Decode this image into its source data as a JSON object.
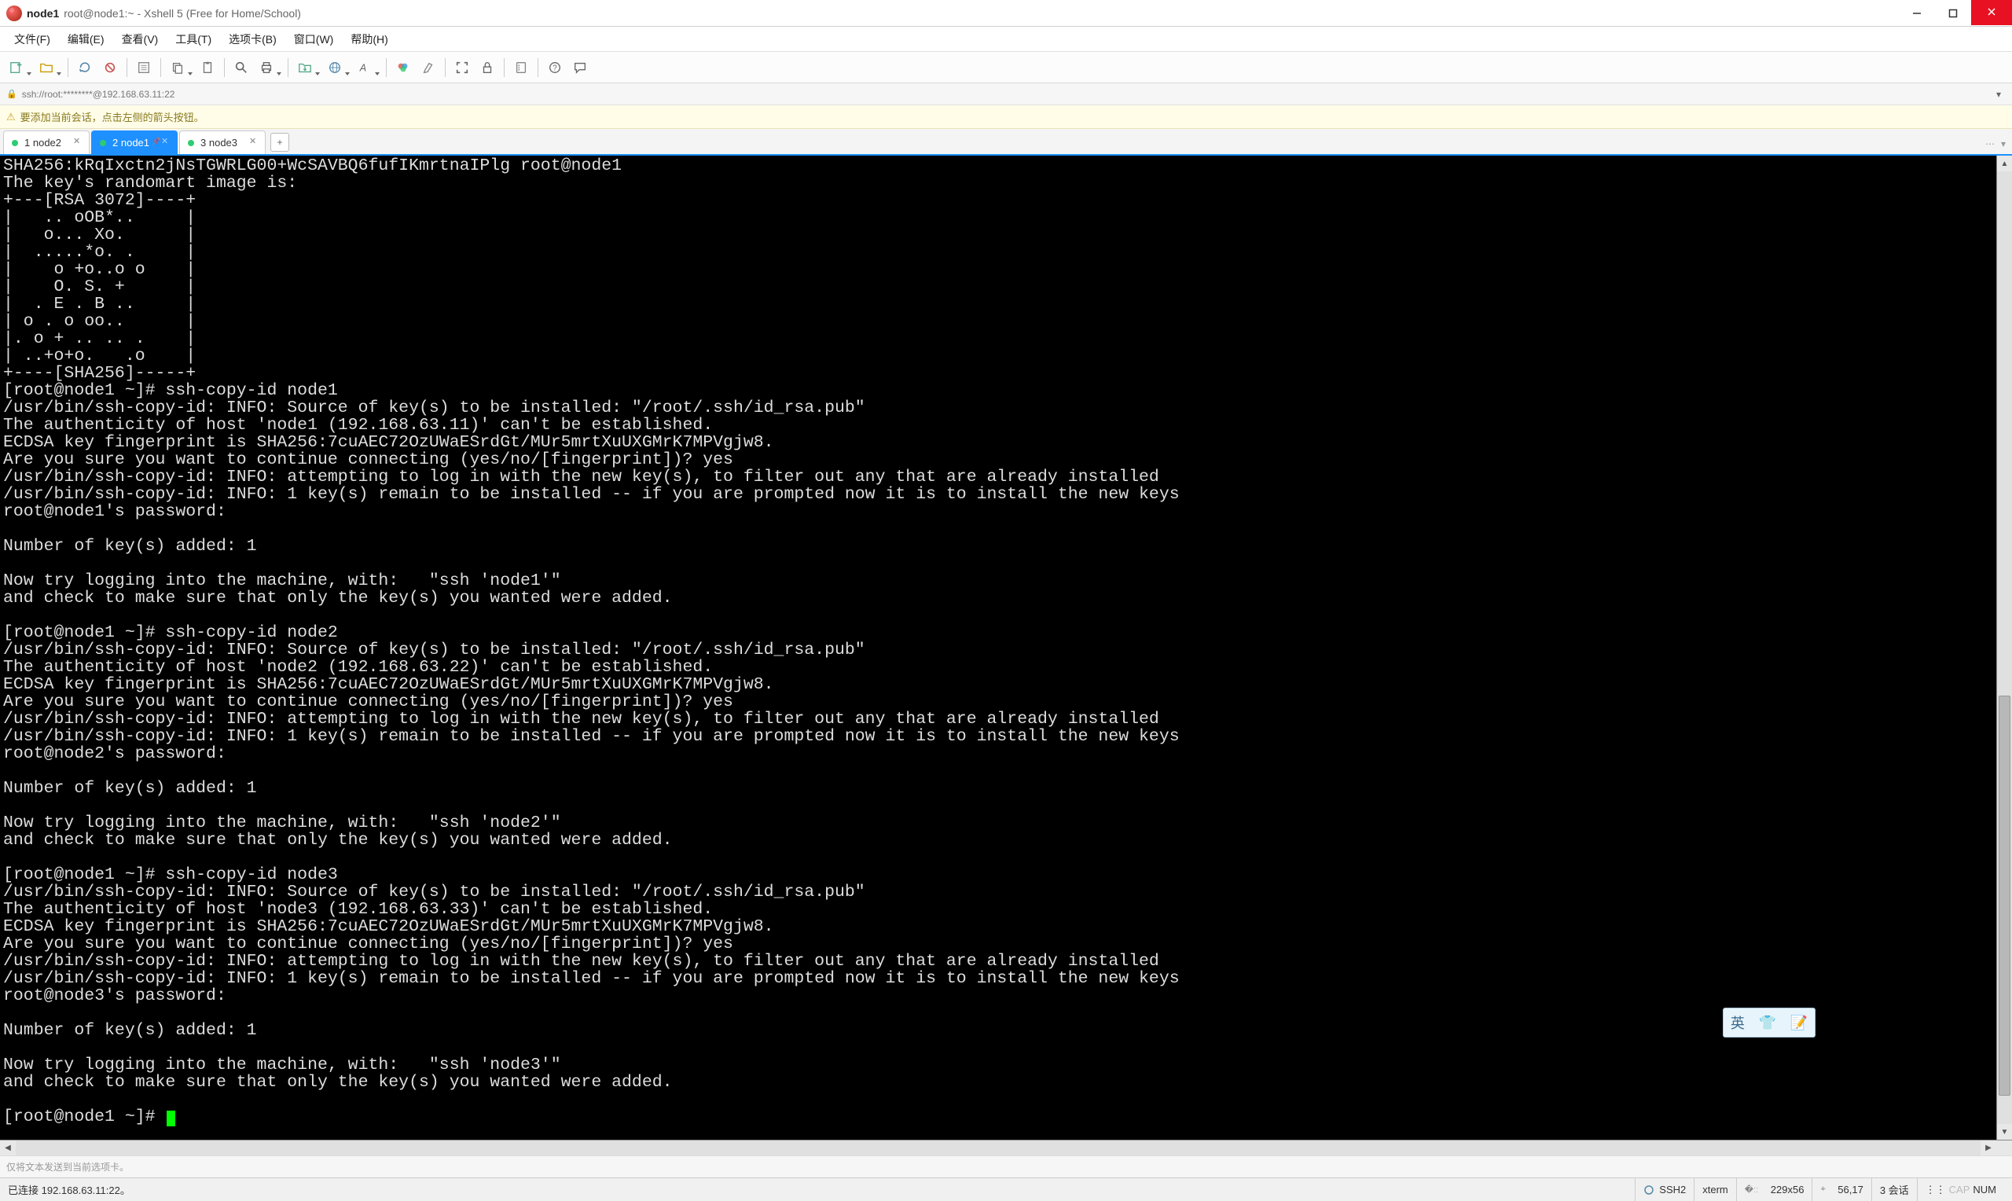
{
  "titleBar": {
    "mainTitle": "node1",
    "subTitle": "root@node1:~ - Xshell 5 (Free for Home/School)"
  },
  "menu": {
    "items": [
      "文件(F)",
      "编辑(E)",
      "查看(V)",
      "工具(T)",
      "选项卡(B)",
      "窗口(W)",
      "帮助(H)"
    ]
  },
  "addressBar": {
    "text": "ssh://root:********@192.168.63.11:22"
  },
  "infoBar": {
    "text": "要添加当前会话，点击左侧的箭头按钮。"
  },
  "tabs": {
    "items": [
      {
        "num": "1",
        "label": "node2",
        "active": false
      },
      {
        "num": "2",
        "label": "node1",
        "active": true
      },
      {
        "num": "3",
        "label": "node3",
        "active": false
      }
    ]
  },
  "terminal": {
    "content": "SHA256:kRqIxctn2jNsTGWRLG00+WcSAVBQ6fufIKmrtnaIPlg root@node1\nThe key's randomart image is:\n+---[RSA 3072]----+\n|   .. oOB*..     |\n|   o... Xo.      |\n|  .....*o. .     |\n|    o +o..o o    |\n|    O. S. +      |\n|  . E . B ..     |\n| o . o oo..      |\n|. o + .. .. .    |\n| ..+o+o.   .o    |\n+----[SHA256]-----+\n[root@node1 ~]# ssh-copy-id node1\n/usr/bin/ssh-copy-id: INFO: Source of key(s) to be installed: \"/root/.ssh/id_rsa.pub\"\nThe authenticity of host 'node1 (192.168.63.11)' can't be established.\nECDSA key fingerprint is SHA256:7cuAEC72OzUWaESrdGt/MUr5mrtXuUXGMrK7MPVgjw8.\nAre you sure you want to continue connecting (yes/no/[fingerprint])? yes\n/usr/bin/ssh-copy-id: INFO: attempting to log in with the new key(s), to filter out any that are already installed\n/usr/bin/ssh-copy-id: INFO: 1 key(s) remain to be installed -- if you are prompted now it is to install the new keys\nroot@node1's password: \n\nNumber of key(s) added: 1\n\nNow try logging into the machine, with:   \"ssh 'node1'\"\nand check to make sure that only the key(s) you wanted were added.\n\n[root@node1 ~]# ssh-copy-id node2\n/usr/bin/ssh-copy-id: INFO: Source of key(s) to be installed: \"/root/.ssh/id_rsa.pub\"\nThe authenticity of host 'node2 (192.168.63.22)' can't be established.\nECDSA key fingerprint is SHA256:7cuAEC72OzUWaESrdGt/MUr5mrtXuUXGMrK7MPVgjw8.\nAre you sure you want to continue connecting (yes/no/[fingerprint])? yes\n/usr/bin/ssh-copy-id: INFO: attempting to log in with the new key(s), to filter out any that are already installed\n/usr/bin/ssh-copy-id: INFO: 1 key(s) remain to be installed -- if you are prompted now it is to install the new keys\nroot@node2's password: \n\nNumber of key(s) added: 1\n\nNow try logging into the machine, with:   \"ssh 'node2'\"\nand check to make sure that only the key(s) you wanted were added.\n\n[root@node1 ~]# ssh-copy-id node3\n/usr/bin/ssh-copy-id: INFO: Source of key(s) to be installed: \"/root/.ssh/id_rsa.pub\"\nThe authenticity of host 'node3 (192.168.63.33)' can't be established.\nECDSA key fingerprint is SHA256:7cuAEC72OzUWaESrdGt/MUr5mrtXuUXGMrK7MPVgjw8.\nAre you sure you want to continue connecting (yes/no/[fingerprint])? yes\n/usr/bin/ssh-copy-id: INFO: attempting to log in with the new key(s), to filter out any that are already installed\n/usr/bin/ssh-copy-id: INFO: 1 key(s) remain to be installed -- if you are prompted now it is to install the new keys\nroot@node3's password: \n\nNumber of key(s) added: 1\n\nNow try logging into the machine, with:   \"ssh 'node3'\"\nand check to make sure that only the key(s) you wanted were added.\n\n[root@node1 ~]# "
  },
  "hintBar": {
    "text": "仅将文本发送到当前选项卡。"
  },
  "statusBar": {
    "left": "已连接 192.168.63.11:22。",
    "proto": "SSH2",
    "termType": "xterm",
    "size": "229x56",
    "cursor": "56,17",
    "sessions": "3 会话",
    "caps": "CAP",
    "num": "NUM"
  },
  "ime": {
    "lang": "英"
  },
  "colors": {
    "accent": "#1e90ff",
    "termBg": "#000000",
    "termFg": "#dddddd",
    "cursor": "#00ff00"
  }
}
